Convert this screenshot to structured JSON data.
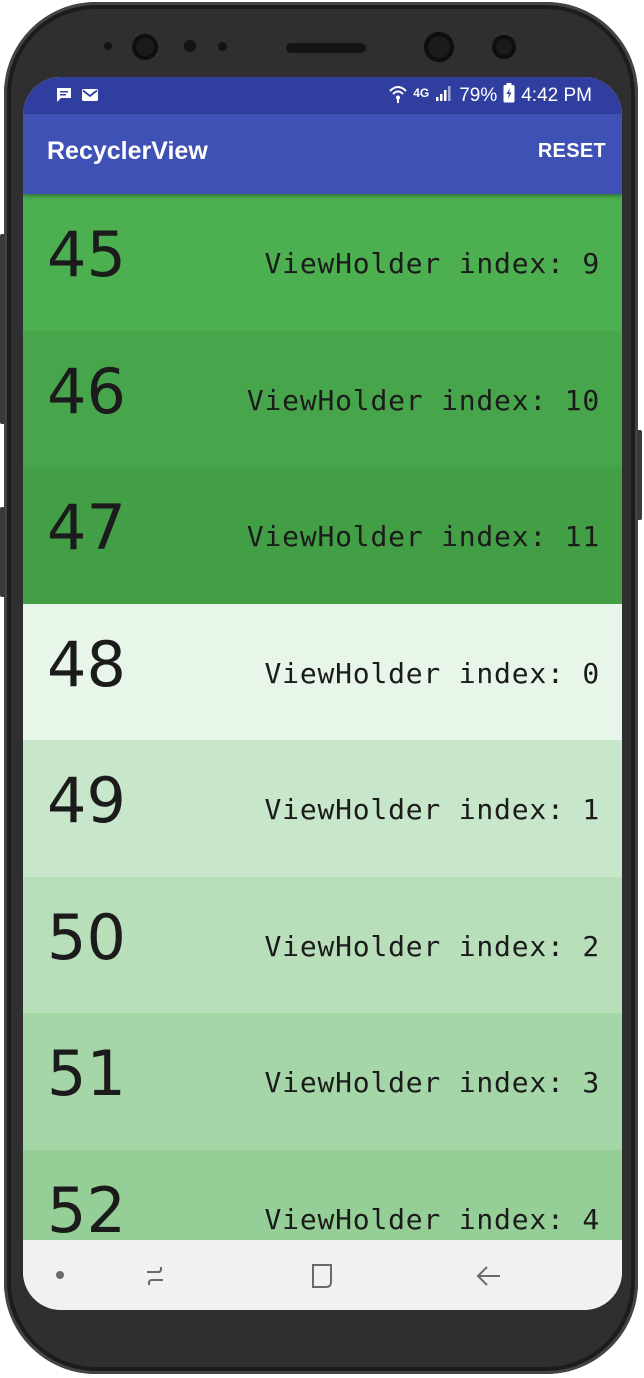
{
  "status_bar": {
    "battery": "79%",
    "time": "4:42 PM",
    "network": "4G",
    "icons": [
      "message-icon",
      "mail-icon",
      "wifi-icon",
      "signal-icon",
      "battery-icon"
    ]
  },
  "app_bar": {
    "title": "RecyclerView",
    "action": "RESET"
  },
  "rows": [
    {
      "number": "45",
      "label": "ViewHolder index: 9",
      "color": "#4caf50"
    },
    {
      "number": "46",
      "label": "ViewHolder index: 10",
      "color": "#47a64b"
    },
    {
      "number": "47",
      "label": "ViewHolder index: 11",
      "color": "#439f46"
    },
    {
      "number": "48",
      "label": "ViewHolder index: 0",
      "color": "#e8f5e9"
    },
    {
      "number": "49",
      "label": "ViewHolder index: 1",
      "color": "#c8e6c9"
    },
    {
      "number": "50",
      "label": "ViewHolder index: 2",
      "color": "#b8dfb9"
    },
    {
      "number": "51",
      "label": "ViewHolder index: 3",
      "color": "#a5d6a7"
    },
    {
      "number": "52",
      "label": "ViewHolder index: 4",
      "color": "#95cf97"
    }
  ],
  "nav_bar": {
    "icons": [
      "recents-dot-icon",
      "recent-apps-icon",
      "home-icon",
      "back-icon"
    ]
  },
  "colors": {
    "status_bar": "#303f9f",
    "app_bar": "#3f51b5",
    "nav_bar": "#f1f1f1"
  }
}
